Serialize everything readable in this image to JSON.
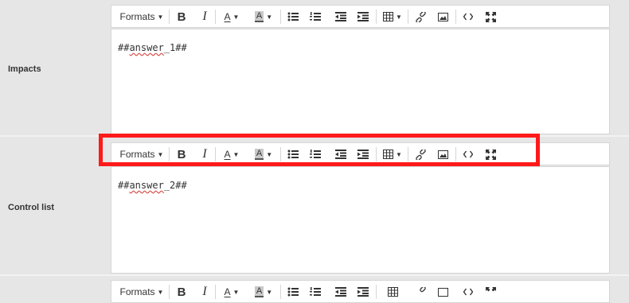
{
  "rows": [
    {
      "label": "Impacts",
      "content": {
        "prefix": "##",
        "word": "answer",
        "suffix": "_1##"
      }
    },
    {
      "label": "Control list",
      "content": {
        "prefix": "##",
        "word": "answer",
        "suffix": "_2##"
      }
    },
    {
      "label": "",
      "content": null
    }
  ],
  "toolbar": {
    "formats_label": "Formats",
    "bold": "B",
    "italic": "I",
    "text_color": "A",
    "background_color": "A",
    "icons": [
      "bullet-list-icon",
      "numbered-list-icon",
      "outdent-icon",
      "indent-icon",
      "table-icon",
      "link-icon",
      "image-icon",
      "code-icon",
      "fullscreen-icon"
    ]
  },
  "colors": {
    "highlight_border": "#ff1a1a",
    "page_background": "#e6e6e6",
    "editor_background": "#ffffff"
  }
}
